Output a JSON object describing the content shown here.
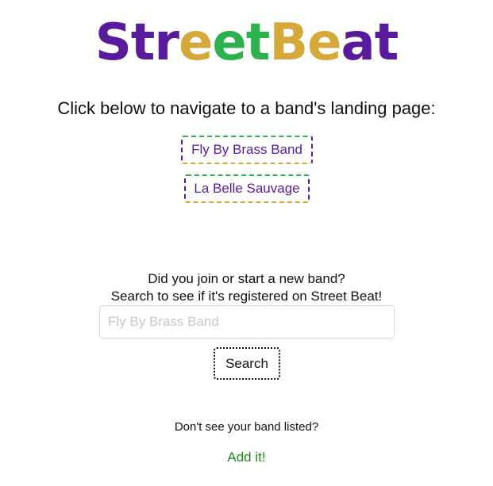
{
  "logo": {
    "text": "StreetBeat",
    "segments": [
      {
        "text": "Str",
        "color": "#5a1a9c"
      },
      {
        "text": "e",
        "color": "#d4a93a"
      },
      {
        "text": "e",
        "color": "#2bb24c"
      },
      {
        "text": "t",
        "color": "#2bb24c"
      },
      {
        "text": "Be",
        "color": "#d4a93a"
      },
      {
        "text": "a",
        "color": "#5a1a9c"
      },
      {
        "text": "t",
        "color": "#5a1a9c"
      }
    ]
  },
  "heading": "Click below to navigate to a band's landing page:",
  "bands": [
    {
      "label": "Fly By Brass Band"
    },
    {
      "label": "La Belle Sauvage"
    }
  ],
  "search": {
    "prompt_line1": "Did you join or start a new band?",
    "prompt_line2": "Search to see if it's registered on Street Beat!",
    "placeholder": "Fly By Brass Band",
    "value": "",
    "button_label": "Search"
  },
  "add": {
    "prompt": "Don't see your band listed?",
    "link_label": "Add it!"
  },
  "colors": {
    "purple": "#5a1a9c",
    "gold": "#d4a93a",
    "green": "#2bb24c",
    "link_green": "#1e8a1e"
  }
}
